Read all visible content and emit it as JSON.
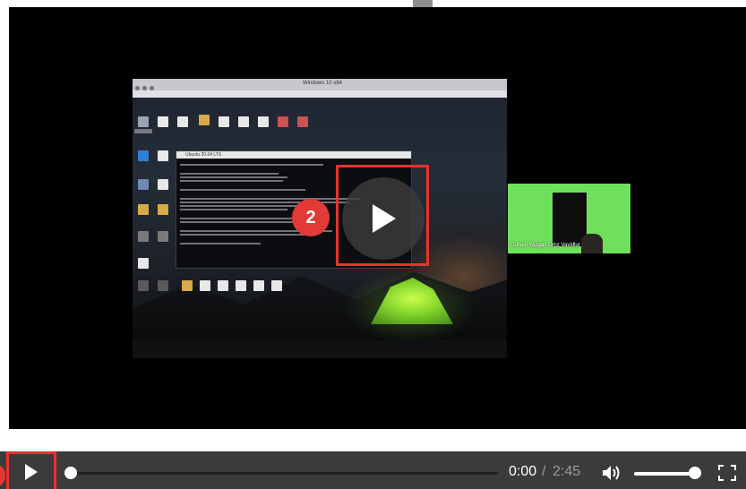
{
  "player": {
    "badge_number": "2",
    "shared_window_title": "Windows 10 x64",
    "terminal_title": "Ubuntu 20.04 LTS",
    "webcam_name": "Gulsen Yazgan Omz Vavidlur"
  },
  "controls": {
    "time_current": "0:00",
    "time_separator": "/",
    "time_total": "2:45",
    "playback_progress_fraction": 0,
    "volume_fraction": 1
  },
  "colors": {
    "highlight": "#e8322f",
    "badge": "#e23a36",
    "control_bar": "#3b3b3b",
    "webcam_bg": "#6fe05b"
  },
  "icons": {
    "play": "play-icon",
    "volume": "volume-icon",
    "fullscreen": "fullscreen-icon"
  }
}
